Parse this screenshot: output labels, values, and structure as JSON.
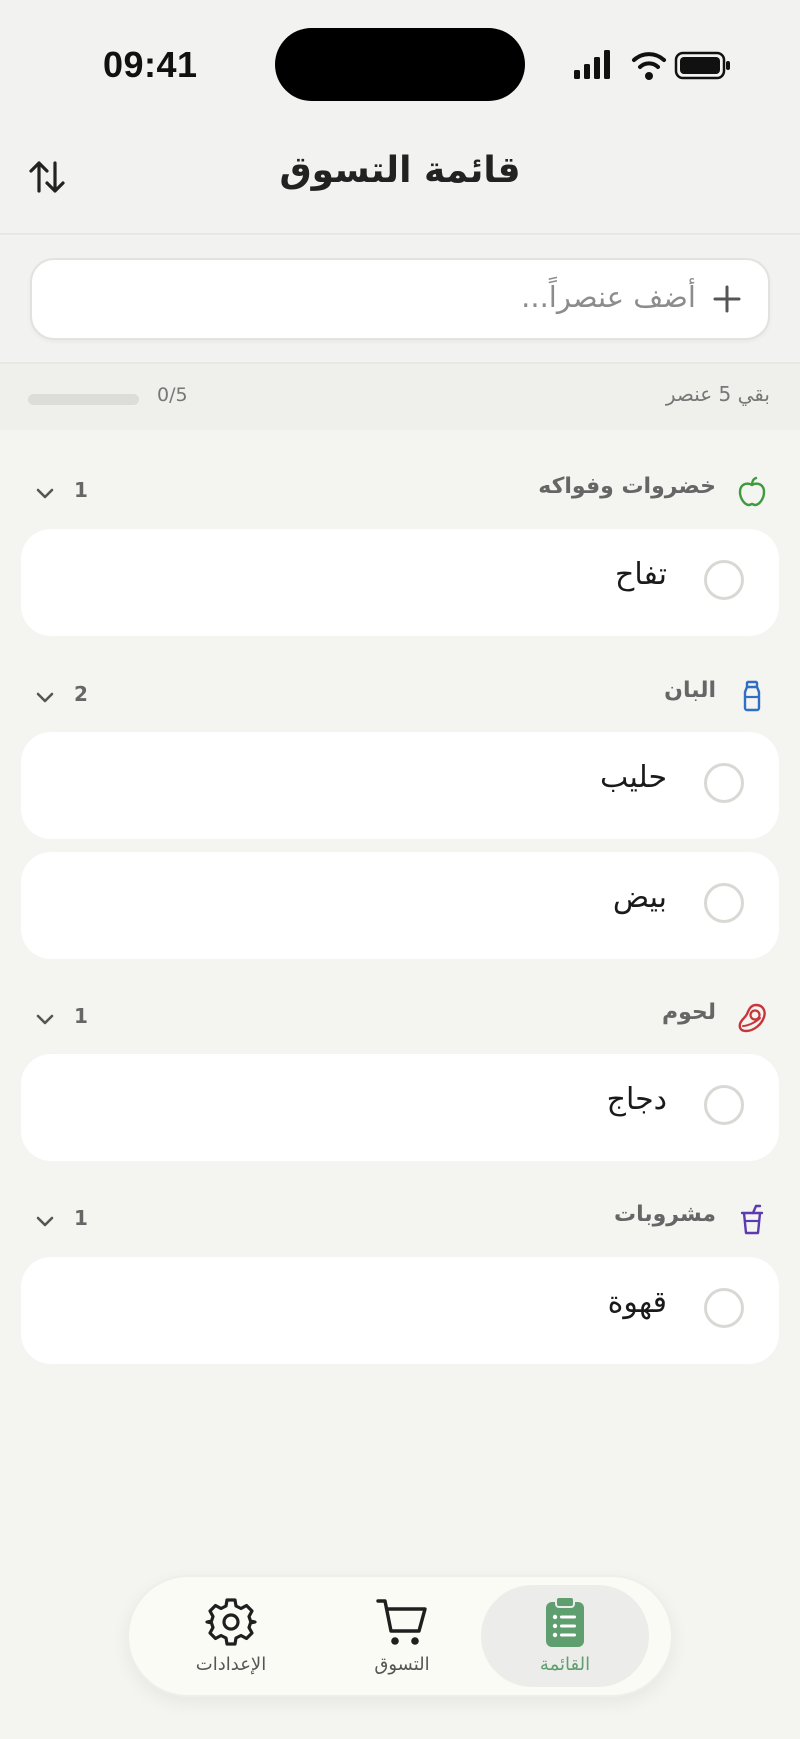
{
  "status_bar": {
    "time": "09:41",
    "icons": [
      "signal-icon",
      "wifi-icon",
      "battery-icon"
    ]
  },
  "header": {
    "title": "قائمة التسوق",
    "sort_icon": "sort-arrows-icon"
  },
  "add_item": {
    "placeholder": "أضف عنصراً...",
    "icon": "plus-icon"
  },
  "progress": {
    "remaining_text": "بقي 5 عنصر",
    "count_text": "0/5",
    "fraction": 0
  },
  "categories": [
    {
      "name": "خضروات وفواكه",
      "count": "1",
      "icon": "apple-icon",
      "color": "#3f9a3f",
      "items": [
        {
          "label": "تفاح",
          "checked": false
        }
      ]
    },
    {
      "name": "البان",
      "count": "2",
      "icon": "milk-bottle-icon",
      "color": "#2f6fc4",
      "items": [
        {
          "label": "حليب",
          "checked": false
        },
        {
          "label": "بيض",
          "checked": false
        }
      ]
    },
    {
      "name": "لحوم",
      "count": "1",
      "icon": "meat-icon",
      "color": "#c8353b",
      "items": [
        {
          "label": "دجاج",
          "checked": false
        }
      ]
    },
    {
      "name": "مشروبات",
      "count": "1",
      "icon": "drink-cup-icon",
      "color": "#5a3cb0",
      "items": [
        {
          "label": "قهوة",
          "checked": false
        }
      ]
    }
  ],
  "tab_bar": {
    "tabs": [
      {
        "label": "القائمة",
        "icon": "clipboard-list-icon",
        "active": true
      },
      {
        "label": "التسوق",
        "icon": "cart-icon",
        "active": false
      },
      {
        "label": "الإعدادات",
        "icon": "gear-icon",
        "active": false
      }
    ]
  },
  "colors": {
    "accent": "#5f9e6e",
    "background": "#f4f4f0"
  }
}
